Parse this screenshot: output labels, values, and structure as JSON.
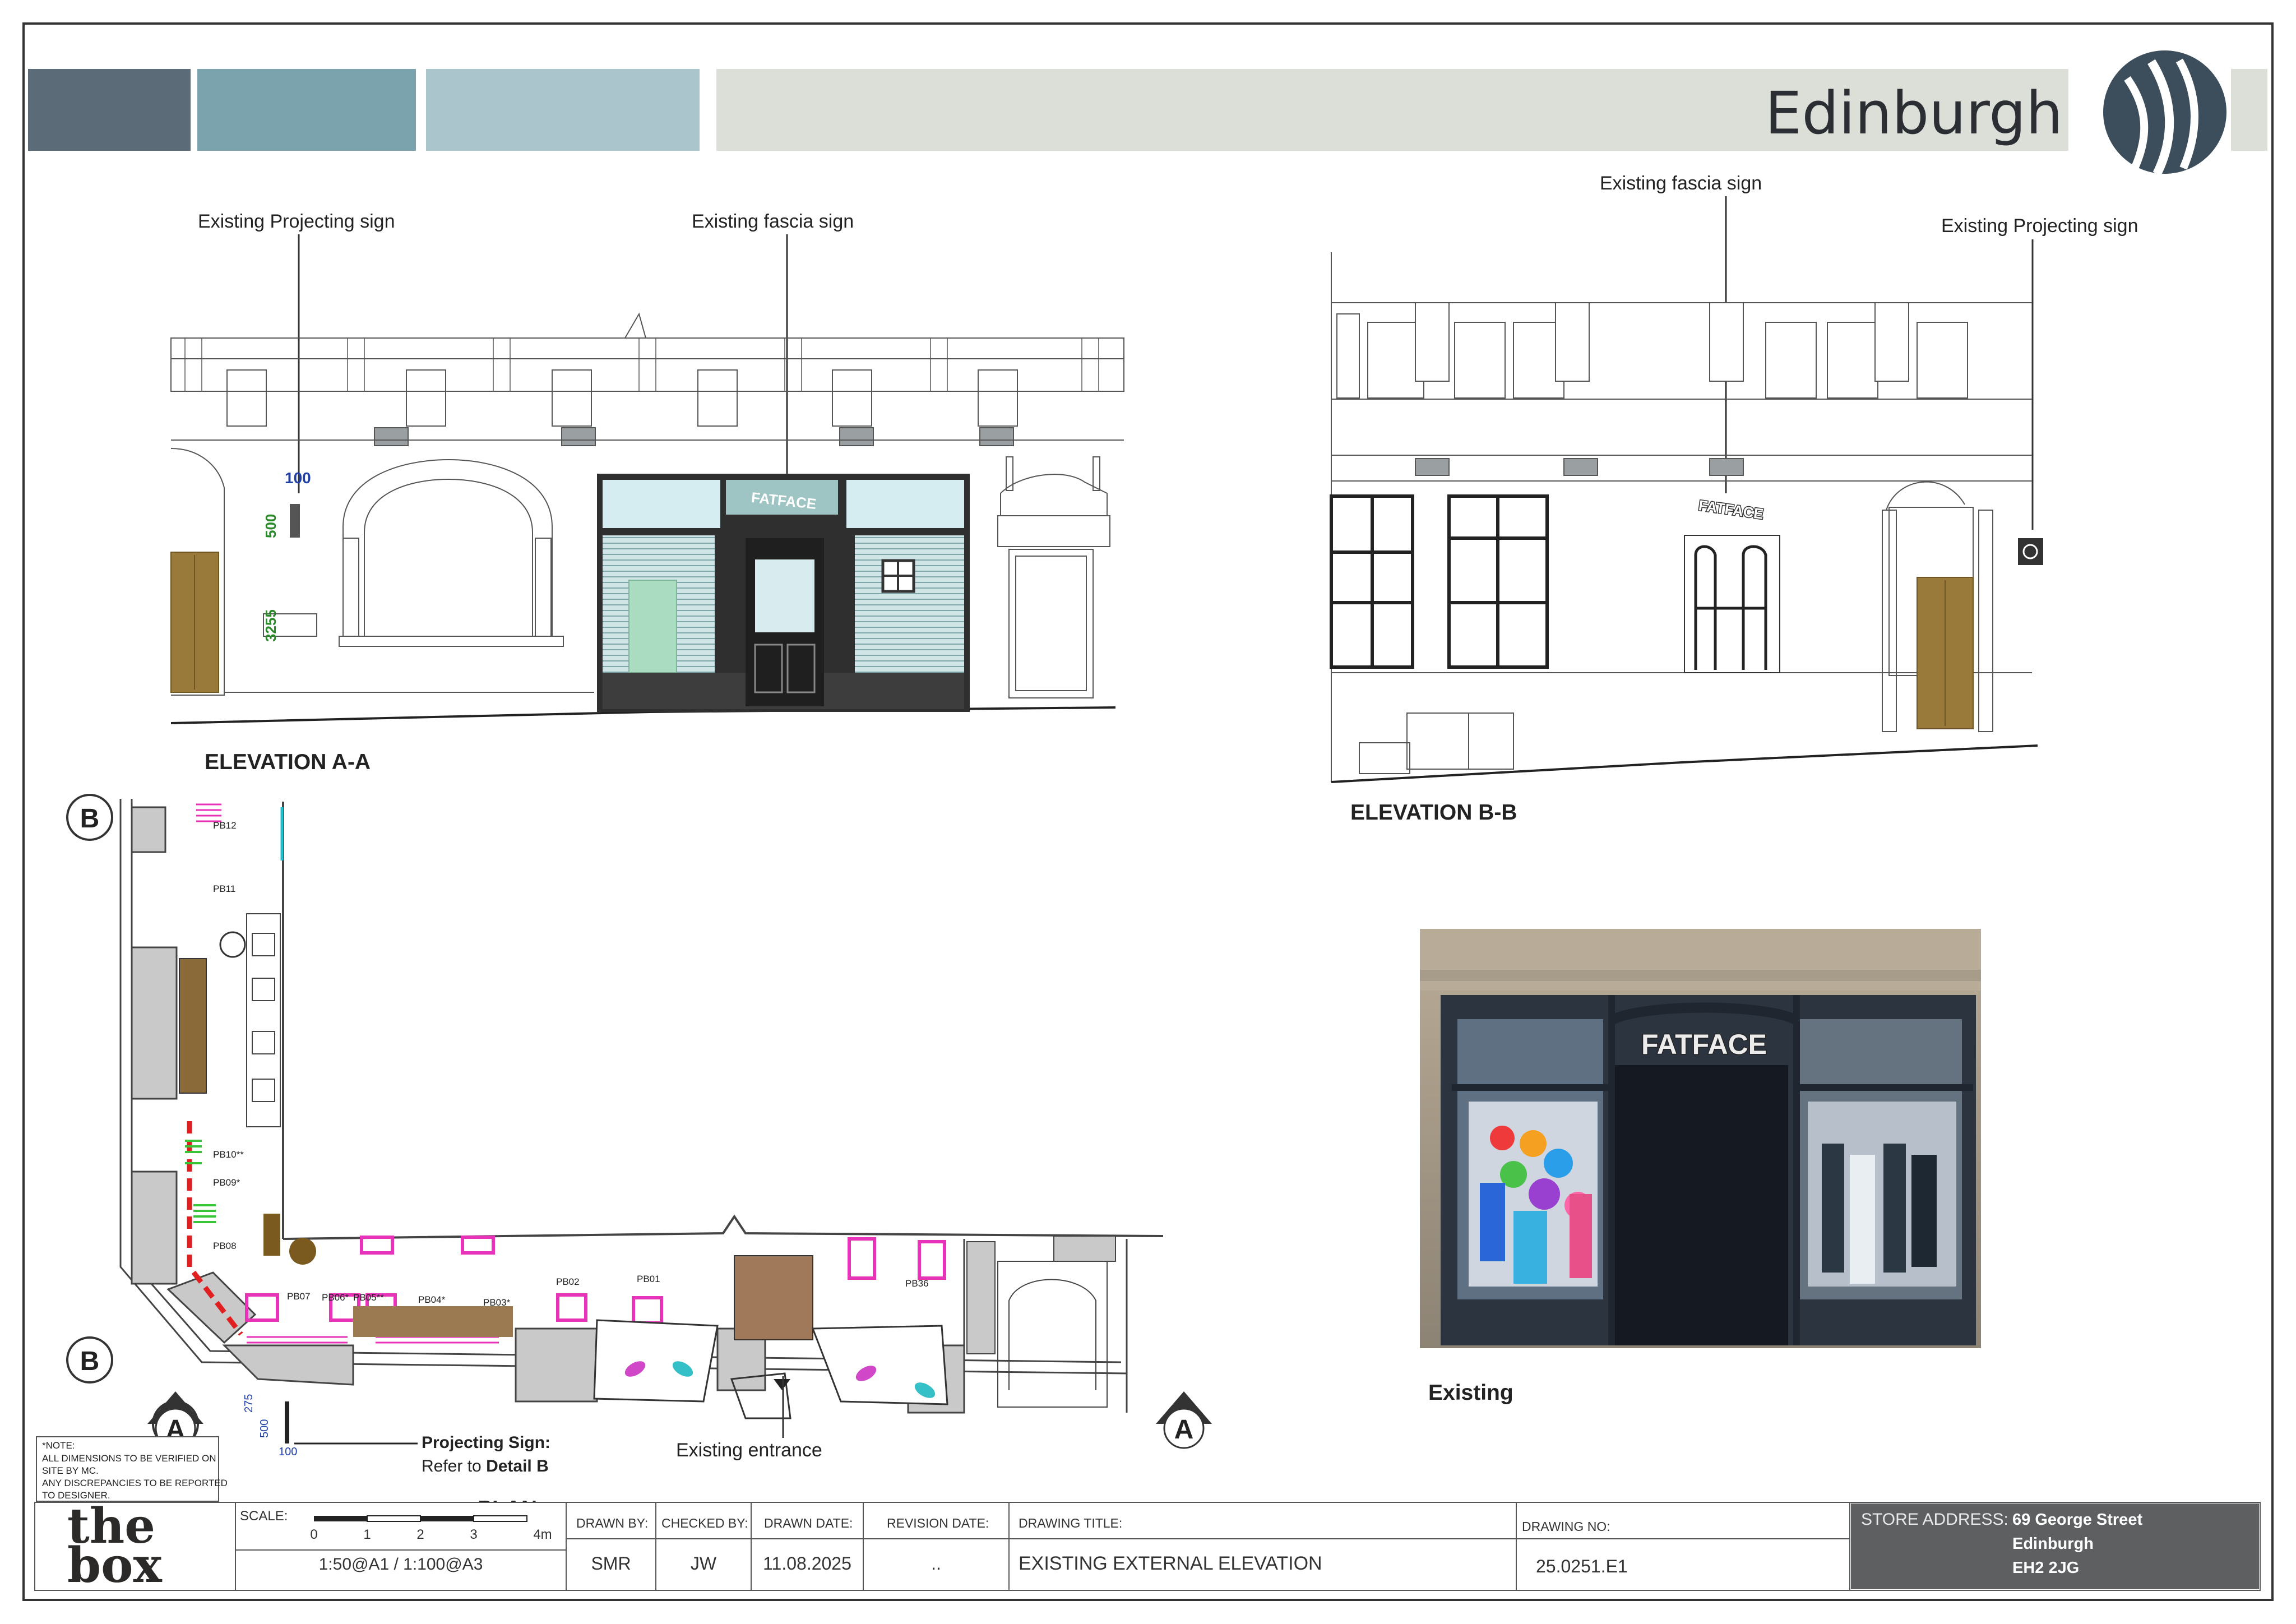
{
  "header": {
    "title": "Edinburgh",
    "swatches": [
      "#5b6b78",
      "#7ba3ae",
      "#aac6cc",
      "#dcdfd8"
    ]
  },
  "elevation_a": {
    "title": "ELEVATION A-A",
    "label_projecting": "Existing Projecting sign",
    "label_fascia": "Existing fascia sign",
    "dim_100": "100",
    "dim_500": "500",
    "dim_3255": "3255",
    "sign_text": "FATFACE"
  },
  "elevation_b": {
    "title": "ELEVATION B-B",
    "label_fascia": "Existing fascia sign",
    "label_projecting": "Existing Projecting sign",
    "sign_text": "FATFACE"
  },
  "plan": {
    "title": "PLAN",
    "marker_b": "B",
    "marker_a": "A",
    "bays": [
      "PB12",
      "PB11",
      "PB10**",
      "PB09*",
      "PB08",
      "PB07",
      "PB06*",
      "PB05**",
      "PB04*",
      "PB03*",
      "PB02",
      "PB01",
      "PB36"
    ],
    "dim_275": "275",
    "dim_500": "500",
    "dim_100": "100",
    "entrance_label": "Existing entrance",
    "projecting_title": "Projecting Sign:",
    "projecting_refer": "Refer to",
    "projecting_detail": "Detail B",
    "note": [
      "*NOTE:",
      "ALL DIMENSIONS TO BE VERIFIED ON",
      "SITE BY MC.",
      "ANY DISCREPANCIES TO BE REPORTED",
      "TO DESIGNER."
    ]
  },
  "photo": {
    "caption": "Existing",
    "sign_text": "FATFACE"
  },
  "title_block": {
    "logo_line1": "the",
    "logo_line2": "box",
    "scale_label": "SCALE:",
    "scale_ticks": [
      "0",
      "1",
      "2",
      "3",
      "4m"
    ],
    "scale_value": "1:50@A1 / 1:100@A3",
    "drawn_by_label": "DRAWN BY:",
    "drawn_by": "SMR",
    "checked_by_label": "CHECKED BY:",
    "checked_by": "JW",
    "drawn_date_label": "DRAWN DATE:",
    "drawn_date": "11.08.2025",
    "revision_date_label": "REVISION DATE:",
    "revision_date": "..",
    "drawing_title_label": "DRAWING TITLE:",
    "drawing_title": "EXISTING EXTERNAL ELEVATION",
    "drawing_no_label": "DRAWING NO:",
    "drawing_no": "25.0251.E1",
    "store_address_label": "STORE ADDRESS:",
    "store_address": [
      "69 George Street",
      "Edinburgh",
      "EH2 2JG"
    ]
  }
}
